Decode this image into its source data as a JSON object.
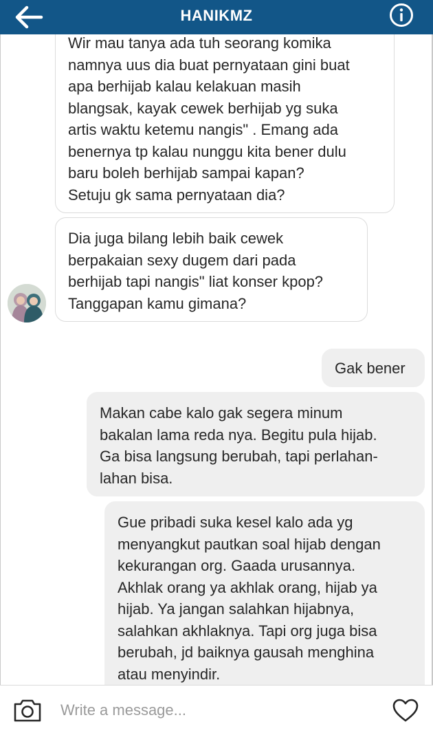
{
  "header": {
    "title": "HANIKMZ",
    "back_icon": "arrow-left-icon",
    "info_icon": "info-circle-icon",
    "background": "#125688"
  },
  "messages": [
    {
      "direction": "incoming",
      "text": "Wir mau tanya ada tuh seorang komika\nnamnya uus dia buat pernyataan gini buat\napa berhijab kalau kelakuan masih\nblangsak, kayak cewek berhijab yg suka\nartis waktu ketemu nangis\" . Emang ada\nbenernya tp kalau nunggu kita bener dulu\nbaru boleh berhijab sampai kapan?\nSetuju gk sama pernyataan dia?"
    },
    {
      "direction": "incoming",
      "text": "Dia juga bilang lebih baik cewek\nberpakaian sexy dugem dari pada\nberhijab tapi nangis\" liat konser kpop?\nTanggapan kamu gimana?"
    },
    {
      "direction": "outgoing",
      "text": "Gak bener"
    },
    {
      "direction": "outgoing",
      "text": "Makan cabe kalo gak segera minum\nbakalan lama reda nya. Begitu pula hijab.\nGa bisa langsung berubah, tapi perlahan-\nlahan bisa."
    },
    {
      "direction": "outgoing",
      "text": "Gue pribadi suka kesel kalo ada yg\nmenyangkut pautkan soal hijab dengan\nkekurangan org. Gaada urusannya.\nAkhlak orang ya akhlak orang, hijab ya\nhijab. Ya jangan salahkan hijabnya,\nsalahkan akhlaknya. Tapi org juga bisa\nberubah, jd baiknya gausah menghina\natau menyindir."
    }
  ],
  "composer": {
    "placeholder": "Write a message...",
    "camera_icon": "camera-icon",
    "heart_icon": "heart-icon"
  }
}
